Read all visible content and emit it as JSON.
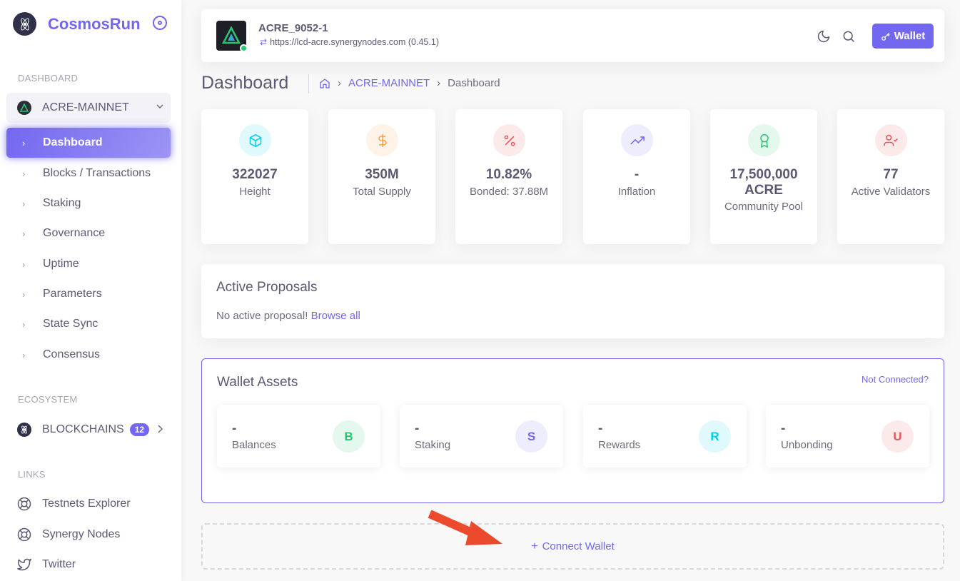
{
  "brand": {
    "name": "CosmosRun"
  },
  "sidebar": {
    "dashboard_header": "DASHBOARD",
    "chain_group": "ACRE-MAINNET",
    "items": [
      {
        "label": "Dashboard",
        "active": true
      },
      {
        "label": "Blocks / Transactions"
      },
      {
        "label": "Staking"
      },
      {
        "label": "Governance"
      },
      {
        "label": "Uptime"
      },
      {
        "label": "Parameters"
      },
      {
        "label": "State Sync"
      },
      {
        "label": "Consensus"
      }
    ],
    "ecosystem_header": "ECOSYSTEM",
    "blockchains": {
      "label": "BLOCKCHAINS",
      "count": "12"
    },
    "links_header": "LINKS",
    "links": [
      {
        "label": "Testnets Explorer",
        "icon": "lifebuoy-icon"
      },
      {
        "label": "Synergy Nodes",
        "icon": "lifebuoy-icon"
      },
      {
        "label": "Twitter",
        "icon": "twitter-icon"
      }
    ]
  },
  "header": {
    "chain_id": "ACRE_9052-1",
    "rpc": "https://lcd-acre.synergynodes.com (0.45.1)",
    "wallet_label": "Wallet",
    "status_color": "#28c76f"
  },
  "breadcrumb": {
    "title": "Dashboard",
    "chain": "ACRE-MAINNET",
    "current": "Dashboard"
  },
  "stats": [
    {
      "value": "322027",
      "label": "Height",
      "icon": "cube-icon",
      "color": "#00cfe8"
    },
    {
      "value": "350M",
      "label": "Total Supply",
      "icon": "dollar-icon",
      "color": "#ff9f43"
    },
    {
      "value": "10.82%",
      "label": "Bonded: 37.88M",
      "icon": "percent-icon",
      "color": "#ea5455"
    },
    {
      "value": "-",
      "label": "Inflation",
      "icon": "trending-up-icon",
      "color": "#7367f0"
    },
    {
      "value": "17,500,000 ACRE",
      "label": "Community Pool",
      "icon": "award-icon",
      "color": "#28c76f"
    },
    {
      "value": "77",
      "label": "Active Validators",
      "icon": "user-check-icon",
      "color": "#ea5455"
    }
  ],
  "proposals": {
    "title": "Active Proposals",
    "message": "No active proposal!",
    "browse_label": "Browse all"
  },
  "wallet_assets": {
    "title": "Wallet Assets",
    "not_connected": "Not Connected?",
    "items": [
      {
        "value": "-",
        "label": "Balances",
        "letter": "B",
        "color": "#28c76f"
      },
      {
        "value": "-",
        "label": "Staking",
        "letter": "S",
        "color": "#7367f0"
      },
      {
        "value": "-",
        "label": "Rewards",
        "letter": "R",
        "color": "#00cfe8"
      },
      {
        "value": "-",
        "label": "Unbonding",
        "letter": "U",
        "color": "#ea5455"
      }
    ]
  },
  "connect": {
    "label": "Connect Wallet"
  }
}
